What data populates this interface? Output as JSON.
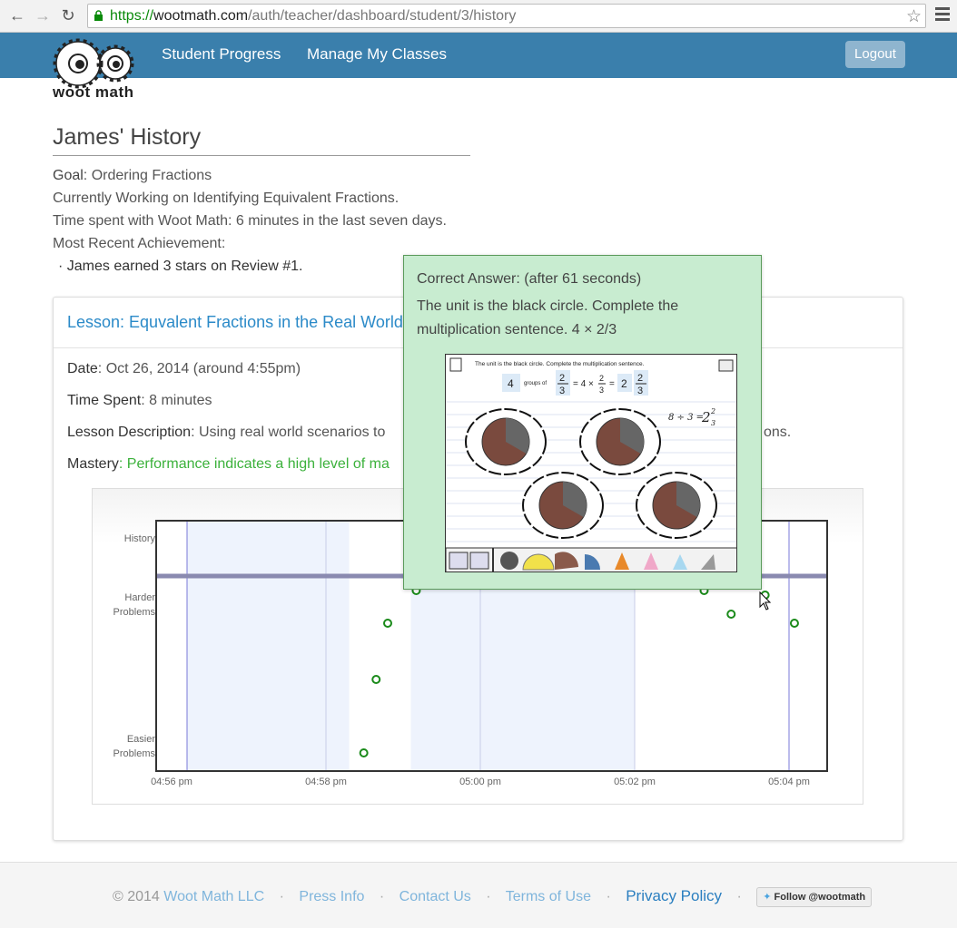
{
  "browser": {
    "url_scheme": "https://",
    "url_host": "wootmath.com",
    "url_path": "/auth/teacher/dashboard/student/3/history"
  },
  "header": {
    "logo_text": "woot math",
    "nav": [
      "Student Progress",
      "Manage My Classes"
    ],
    "logout_label": "Logout"
  },
  "student": {
    "page_title": "James' History",
    "goal_label": "Goal",
    "goal_value": ": Ordering Fractions",
    "currently_working": "Currently Working on Identifying Equivalent Fractions.",
    "time_spent": "Time spent with Woot Math: 6 minutes in the last seven days.",
    "achievement_label": "Most Recent Achievement:",
    "achievement": "· James earned 3 stars on Review #1."
  },
  "lesson": {
    "title": "Lesson: Equvalent Fractions in the Real World",
    "date_label": "Date",
    "date_value": ": Oct 26, 2014 (around 4:55pm)",
    "time_label": "Time Spent",
    "time_value": ": 8 minutes",
    "desc_label": "Lesson Description",
    "desc_value": ": Using real world scenarios to",
    "desc_tail": "ons.",
    "mastery_label": "Mastery",
    "mastery_value": ": Performance indicates a high level of ma"
  },
  "chart_data": {
    "type": "scatter",
    "row_labels": [
      "History",
      "Harder\nProblems",
      "Easier\nProblems"
    ],
    "x_ticks": [
      "04:56 pm",
      "04:58 pm",
      "05:00 pm",
      "05:02 pm",
      "05:04 pm"
    ],
    "x_minutes_range": [
      -0.2,
      8.5
    ],
    "difficulty_range": [
      0,
      10
    ],
    "history_level": 6.9,
    "points": [
      {
        "t": 2.49,
        "level": 0.4
      },
      {
        "t": 2.65,
        "level": 3.3
      },
      {
        "t": 2.8,
        "level": 5.6
      },
      {
        "t": 3.17,
        "level": 6.3
      },
      {
        "t": 6.9,
        "level": 6.3
      },
      {
        "t": 7.25,
        "level": 5.9
      },
      {
        "t": 7.69,
        "level": 6.6
      },
      {
        "t": 8.07,
        "level": 5.6
      }
    ],
    "shaded_bands": [
      [
        0.2,
        2.3
      ],
      [
        3.1,
        6.0
      ]
    ],
    "vlines": [
      0.2,
      2.0,
      4.0,
      6.0,
      8.0
    ],
    "point_color": "#1a8a1a",
    "history_bar_color": "#8a8ab0"
  },
  "tooltip": {
    "line1": "Correct Answer: (after 61 seconds)",
    "line2": "The unit is the black circle. Complete the",
    "line3": "multiplication sentence.    4 × 2/3",
    "thumb_instruction": "The unit is the black circle. Complete the multiplication sentence.",
    "thumb_groups": "4",
    "thumb_groups_of": "groups of",
    "thumb_eq_mid": "= 4 ×",
    "thumb_eq_end": "=",
    "thumb_whole": "2",
    "thumb_num": "2",
    "thumb_den": "3",
    "thumb_note": "8 ÷ 3 ="
  },
  "footer": {
    "copyright": "© 2014",
    "company": "Woot Math LLC",
    "links": [
      "Press Info",
      "Contact Us",
      "Terms of Use"
    ],
    "privacy": "Privacy Policy",
    "twitter": "Follow @wootmath"
  }
}
